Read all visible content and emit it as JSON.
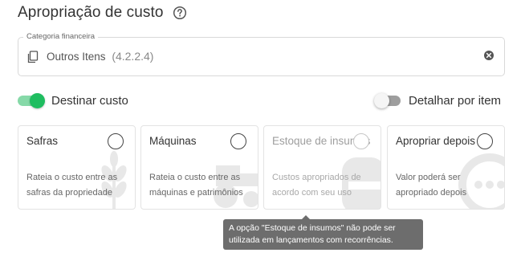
{
  "header": {
    "title": "Apropriação de custo",
    "help_icon": "help-circle-icon"
  },
  "category_field": {
    "label": "Categoria financeira",
    "value": "Outros Itens",
    "code": "(4.2.2.4)",
    "leading_icon": "document-copy-icon",
    "clear_icon": "close-circle-icon"
  },
  "toggles": {
    "destinar_custo": {
      "label": "Destinar custo",
      "checked": true
    },
    "detalhar_por_item": {
      "label": "Detalhar por item",
      "checked": false
    }
  },
  "cards": [
    {
      "title": "Safras",
      "description": "Rateia o custo entre as safras da propriedade",
      "disabled": false,
      "selected": false
    },
    {
      "title": "Máquinas",
      "description": "Rateia o custo entre as máquinas e patrimônios",
      "disabled": false,
      "selected": false
    },
    {
      "title": "Estoque de insumos",
      "description": "Custos apropriados de acordo com seu uso",
      "disabled": true,
      "selected": false
    },
    {
      "title": "Apropriar depois",
      "description": "Valor poderá ser apropriado depois",
      "disabled": false,
      "selected": false
    }
  ],
  "tooltip": {
    "text": "A opção \"Estoque de insumos\" não pode ser utilizada em lançamentos com recorrências."
  },
  "colors": {
    "toggle_on": "#1fbd60",
    "toggle_on_track": "#86d9a8",
    "toggle_off_track": "#9e9e9e",
    "tooltip_bg": "#6d6d6d",
    "border": "#d9d9d9"
  }
}
